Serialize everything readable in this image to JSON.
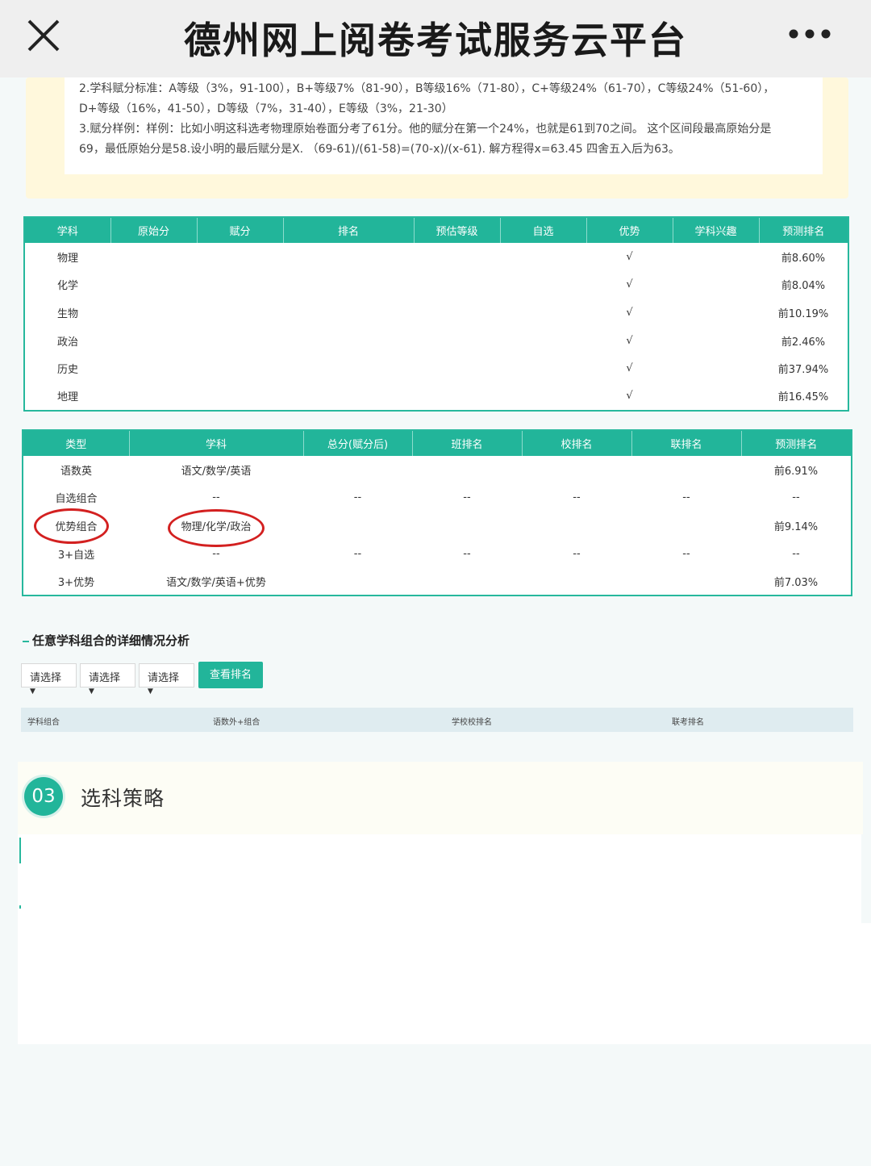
{
  "header": {
    "title": "德州网上阅卷考试服务云平台",
    "close_icon": "close-icon",
    "more_icon": "more-icon"
  },
  "note": {
    "line1": "2.学科赋分标准：A等级（3%，91-100），B+等级7%（81-90），B等级16%（71-80），C+等级24%（61-70），C等级24%（51-60），",
    "line2": "D+等级（16%，41-50），D等级（7%，31-40），E等级（3%，21-30）",
    "line3": "3.赋分样例：样例：比如小明这科选考物理原始卷面分考了61分。他的赋分在第一个24%，也就是61到70之间。 这个区间段最高原始分是",
    "line4": "69，最低原始分是58.设小明的最后赋分是X. （69-61)/(61-58)=(70-x)/(x-61). 解方程得x=63.45 四舍五入后为63。"
  },
  "subject_table": {
    "headers": [
      "学科",
      "原始分",
      "赋分",
      "排名",
      "预估等级",
      "自选",
      "优势",
      "学科兴趣",
      "预测排名"
    ],
    "rows": [
      {
        "subject": "物理",
        "advantage": "√",
        "predicted": "前8.60%"
      },
      {
        "subject": "化学",
        "advantage": "√",
        "predicted": "前8.04%"
      },
      {
        "subject": "生物",
        "advantage": "√",
        "predicted": "前10.19%"
      },
      {
        "subject": "政治",
        "advantage": "√",
        "predicted": "前2.46%"
      },
      {
        "subject": "历史",
        "advantage": "√",
        "predicted": "前37.94%"
      },
      {
        "subject": "地理",
        "advantage": "√",
        "predicted": "前16.45%"
      }
    ]
  },
  "combo_table": {
    "headers": [
      "类型",
      "学科",
      "总分(赋分后)",
      "班排名",
      "校排名",
      "联排名",
      "预测排名"
    ],
    "rows": [
      {
        "type": "语数英",
        "subjects": "语文/数学/英语",
        "total": "",
        "class": "",
        "school": "",
        "joint": "",
        "predicted": "前6.91%"
      },
      {
        "type": "自选组合",
        "subjects": "--",
        "total": "--",
        "class": "--",
        "school": "--",
        "joint": "--",
        "predicted": "--"
      },
      {
        "type": "优势组合",
        "subjects": "物理/化学/政治",
        "total": "",
        "class": "",
        "school": "",
        "joint": "",
        "predicted": "前9.14%"
      },
      {
        "type": "3+自选",
        "subjects": "--",
        "total": "--",
        "class": "--",
        "school": "--",
        "joint": "--",
        "predicted": "--"
      },
      {
        "type": "3+优势",
        "subjects": "语文/数学/英语+优势",
        "total": "",
        "class": "",
        "school": "",
        "joint": "",
        "predicted": "前7.03%"
      }
    ]
  },
  "analysis": {
    "title": "任意学科组合的详细情况分析",
    "select1": "请选择",
    "select2": "请选择",
    "select3": "请选择",
    "button": "查看排名",
    "result_headers": [
      "学科组合",
      "语数外+组合",
      "学校校排名",
      "联考排名"
    ]
  },
  "strategy": {
    "number": "03",
    "title": "选科策略"
  },
  "colors": {
    "accent": "#22b59a",
    "annotation": "#d32020"
  }
}
